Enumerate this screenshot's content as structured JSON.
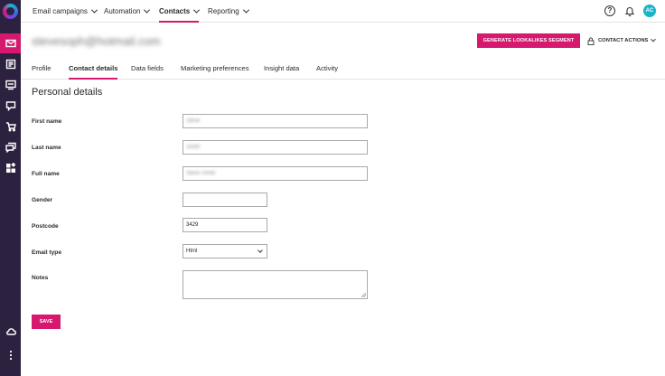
{
  "nav": {
    "items": [
      {
        "label": "Email campaigns"
      },
      {
        "label": "Automation"
      },
      {
        "label": "Contacts"
      },
      {
        "label": "Reporting"
      }
    ],
    "help_glyph": "?",
    "avatar_initials": "AC"
  },
  "header": {
    "email": "stevesoph@hotmail.com",
    "lookalike_button": "GENERATE LOOKALIKES SEGMENT",
    "contact_actions": "CONTACT ACTIONS"
  },
  "tabs": [
    {
      "label": "Profile"
    },
    {
      "label": "Contact details"
    },
    {
      "label": "Data fields"
    },
    {
      "label": "Marketing preferences"
    },
    {
      "label": "Insight data"
    },
    {
      "label": "Activity"
    }
  ],
  "form": {
    "title": "Personal details",
    "first_name": {
      "label": "First name",
      "value": "Steve"
    },
    "last_name": {
      "label": "Last name",
      "value": "Smith"
    },
    "full_name": {
      "label": "Full name",
      "value": "Steve Smith"
    },
    "gender": {
      "label": "Gender",
      "value": ""
    },
    "postcode": {
      "label": "Postcode",
      "value": "3429"
    },
    "email_type": {
      "label": "Email type",
      "value": "Html"
    },
    "notes": {
      "label": "Notes",
      "value": ""
    },
    "save_label": "SAVE"
  },
  "colors": {
    "accent": "#d6186f",
    "rail": "#2c2240",
    "avatar": "#19b4c8"
  }
}
